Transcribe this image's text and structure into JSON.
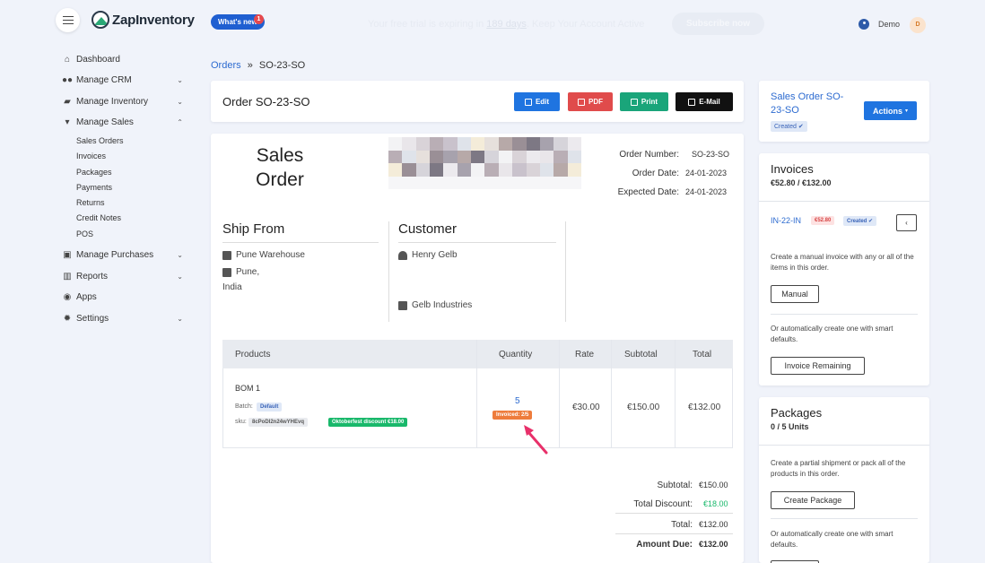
{
  "topbar": {
    "logo_text": "ZapInventory",
    "whats_new": "What's new",
    "whats_new_badge": "1",
    "trial_msg_before": "Your free trial is expiring in ",
    "trial_msg_days": "189 days",
    "trial_msg_after": ". Keep Your Account Active",
    "subscribe": "Subscribe now",
    "user_name": "Demo",
    "user_initial": "D"
  },
  "sidebar": {
    "items": [
      {
        "label": "Dashboard",
        "icon": "home-icon"
      },
      {
        "label": "Manage CRM",
        "icon": "users-icon"
      },
      {
        "label": "Manage Inventory",
        "icon": "truck-icon"
      },
      {
        "label": "Manage Sales",
        "icon": "cart-icon"
      },
      {
        "label": "Manage Purchases",
        "icon": "basket-icon"
      },
      {
        "label": "Reports",
        "icon": "chart-icon"
      },
      {
        "label": "Apps",
        "icon": "circle-up-icon"
      },
      {
        "label": "Settings",
        "icon": "gear-icon"
      }
    ],
    "sales_sub": [
      "Sales Orders",
      "Invoices",
      "Packages",
      "Payments",
      "Returns",
      "Credit Notes",
      "POS"
    ]
  },
  "breadcrumb": {
    "parent": "Orders",
    "sep": "»",
    "current": "SO-23-SO"
  },
  "header": {
    "title": "Order SO-23-SO",
    "edit": "Edit",
    "pdf": "PDF",
    "print": "Print",
    "email": "E-Mail"
  },
  "doc": {
    "title_line1": "Sales",
    "title_line2": "Order",
    "order_number_label": "Order Number:",
    "order_number": "SO-23-SO",
    "order_date_label": "Order Date:",
    "order_date": "24-01-2023",
    "expected_date_label": "Expected Date:",
    "expected_date": "24-01-2023",
    "ship_from_title": "Ship From",
    "warehouse": "Pune Warehouse",
    "city": "Pune,",
    "country": "India",
    "customer_title": "Customer",
    "customer_name": "Henry Gelb",
    "company": "Gelb Industries"
  },
  "table": {
    "headers": [
      "Products",
      "Quantity",
      "Rate",
      "Subtotal",
      "Total"
    ],
    "row": {
      "product": "BOM 1",
      "batch_label": "Batch:",
      "batch_value": "Default",
      "sku_label": "sku:",
      "sku_value": "8cPoDl2n24wYHEvq",
      "discount_badge": "Oktoberfest discount €18.00",
      "quantity": "5",
      "invoiced": "Invoiced: 2/5",
      "rate": "€30.00",
      "subtotal": "€150.00",
      "total": "€132.00"
    }
  },
  "totals": {
    "subtotal_label": "Subtotal:",
    "subtotal": "€150.00",
    "discount_label": "Total Discount:",
    "discount": "€18.00",
    "total_label": "Total:",
    "total": "€132.00",
    "amount_due_label": "Amount Due:",
    "amount_due": "€132.00"
  },
  "side_summary": {
    "title": "Sales Order SO-23-SO",
    "status": "Created",
    "actions": "Actions"
  },
  "invoices_card": {
    "title": "Invoices",
    "amounts": "€52.80 / €132.00",
    "invoice_id": "IN-22-IN",
    "invoice_amount": "€52.80",
    "invoice_status": "Created",
    "manual_text": "Create a manual invoice with any or all of the items in this order.",
    "manual_btn": "Manual",
    "auto_text": "Or automatically create one with smart defaults.",
    "auto_btn": "Invoice Remaining"
  },
  "packages_card": {
    "title": "Packages",
    "units": "0 / 5 Units",
    "partial_text": "Create a partial shipment or pack all of the products in this order.",
    "create_btn": "Create Package",
    "auto_text": "Or automatically create one with smart defaults."
  },
  "colors": {
    "primary": "#1f74e0",
    "pdf": "#e04b4b",
    "print": "#1aa57a",
    "email": "#111111",
    "invoiced_badge": "#ee7c3c",
    "discount_green": "#19b86b",
    "arrow": "#e8306a"
  }
}
